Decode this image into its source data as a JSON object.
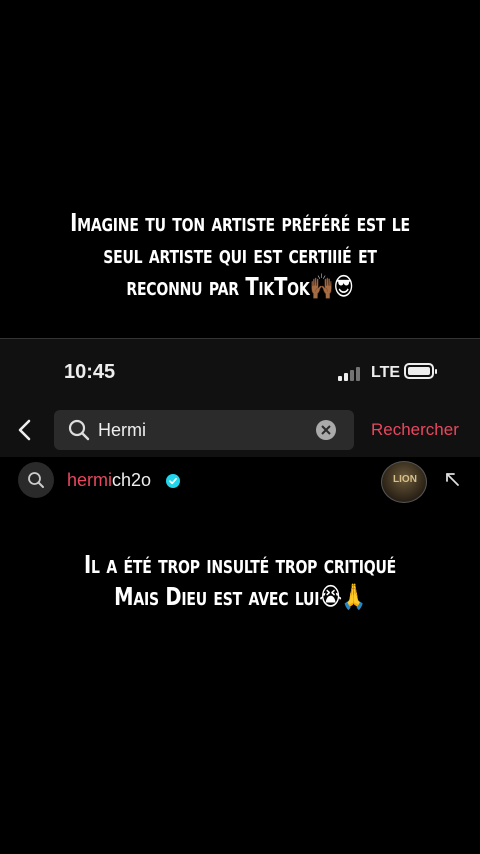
{
  "caption_top": {
    "line1": "Imagine tu ton artiste préféré est le",
    "line2": "seul artiste qui est certiiié et",
    "line3": "reconnu par TikTok🙌🏾😎"
  },
  "status_bar": {
    "time": "10:45",
    "network": "LTE"
  },
  "search": {
    "query": "Hermi",
    "submit_label": "Rechercher"
  },
  "suggestion": {
    "highlight": "hermi",
    "rest": "ch2o",
    "avatar_text": "LION"
  },
  "caption_bottom": {
    "line1": "Il a été trop insulté trop critiqué",
    "line2": "Mais Dieu est avec lui😭🙏"
  },
  "colors": {
    "accent": "#e8475f",
    "verified": "#20d5ec",
    "background": "#000000"
  }
}
